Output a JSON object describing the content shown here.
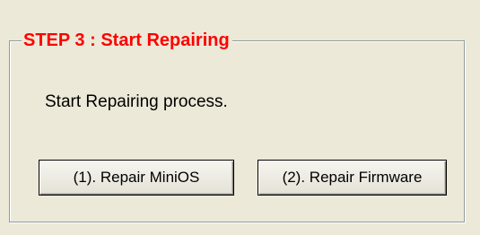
{
  "group": {
    "title": "STEP 3 : Start Repairing",
    "title_color": "#ff0000",
    "description": "Start Repairing process."
  },
  "buttons": {
    "repair_minios": "(1). Repair MiniOS",
    "repair_firmware": "(2). Repair Firmware"
  },
  "colors": {
    "panel_background": "#ece9d8"
  }
}
